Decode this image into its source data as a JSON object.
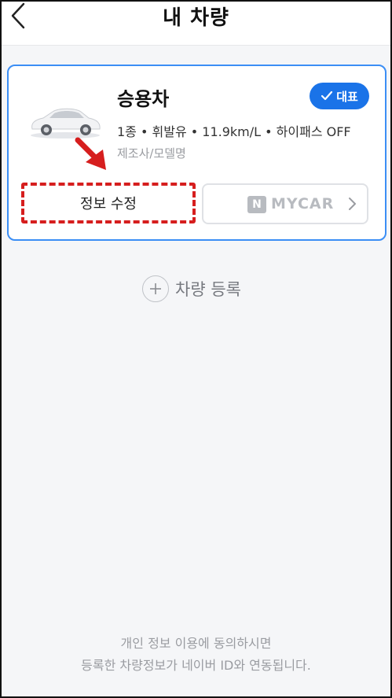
{
  "header": {
    "title": "내 차량",
    "back_icon": "chevron-left-icon"
  },
  "vehicle_card": {
    "name": "승용차",
    "badge_label": "대표",
    "specs": "1종 • 휘발유 • 11.9km/L • 하이패스 OFF",
    "model": "제조사/모델명",
    "edit_label": "정보 수정",
    "mycar_logo_letter": "N",
    "mycar_label": "MYCAR",
    "accent_color": "#1a73e8",
    "annotation_color": "#d61e1e"
  },
  "add_vehicle": {
    "label": "차량 등록",
    "icon": "plus-circle-icon"
  },
  "footer": {
    "line1": "개인 정보 이용에 동의하시면",
    "line2": "등록한 차량정보가 네이버 ID와 연동됩니다."
  }
}
